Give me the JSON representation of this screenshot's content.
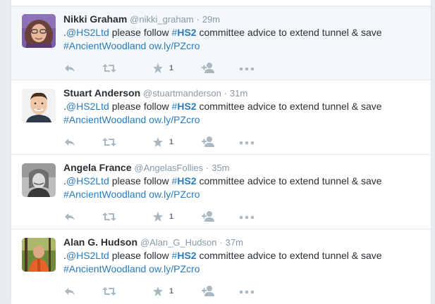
{
  "colors": {
    "link": "#2b7bb9",
    "muted": "#8899a6",
    "icon": "#aab8c2",
    "selection": "#3399ff"
  },
  "tweets": [
    {
      "name_selected": "Nikki Graha",
      "name_rest": "m",
      "username": "@nikki_graham",
      "time": "29m",
      "text_prefix": ".",
      "mention": "@HS2Ltd",
      "text_mid": " please follow ",
      "hash_symbol": "#",
      "hash_tag": "HS2",
      "text_after": " committee advice to extend tunnel & save",
      "hashtag2": "#AncientWoodland",
      "url": "ow.ly/PZcro",
      "favorite_count": "1",
      "avatar": "woman-glasses-purple"
    },
    {
      "name": "Stuart Anderson",
      "username": "@stuartmanderson",
      "time": "31m",
      "text_prefix": ".",
      "mention": "@HS2Ltd",
      "text_mid": " please follow ",
      "hash_symbol": "#",
      "hash_tag": "HS2",
      "text_after": " committee advice to extend tunnel & save",
      "hashtag2": "#AncientWoodland",
      "url": "ow.ly/PZcro",
      "favorite_count": "1",
      "avatar": "man-dark-hair"
    },
    {
      "name": "Angela France",
      "username": "@AngelasFollies",
      "time": "35m",
      "text_prefix": ".",
      "mention": "@HS2Ltd",
      "text_mid": " please follow ",
      "hash_symbol": "#",
      "hash_tag": "HS2",
      "text_after": " committee advice to extend tunnel & save",
      "hashtag2": "#AncientWoodland",
      "url": "ow.ly/PZcro",
      "favorite_count": "1",
      "avatar": "woman-black-and-white"
    },
    {
      "name": "Alan G. Hudson",
      "username": "@Alan_G_Hudson",
      "time": "37m",
      "text_prefix": ".",
      "mention": "@HS2Ltd",
      "text_mid": " please follow ",
      "hash_symbol": "#",
      "hash_tag": "HS2",
      "text_after": " committee advice to extend tunnel & save",
      "hashtag2": "#AncientWoodland",
      "url": "ow.ly/PZcro",
      "favorite_count": "1",
      "avatar": "man-orange-jacket-forest"
    }
  ],
  "separator": "·",
  "icons": {
    "reply": "reply-icon",
    "retweet": "retweet-icon",
    "favorite": "star-icon",
    "follow": "follow-icon",
    "more": "more-icon"
  }
}
